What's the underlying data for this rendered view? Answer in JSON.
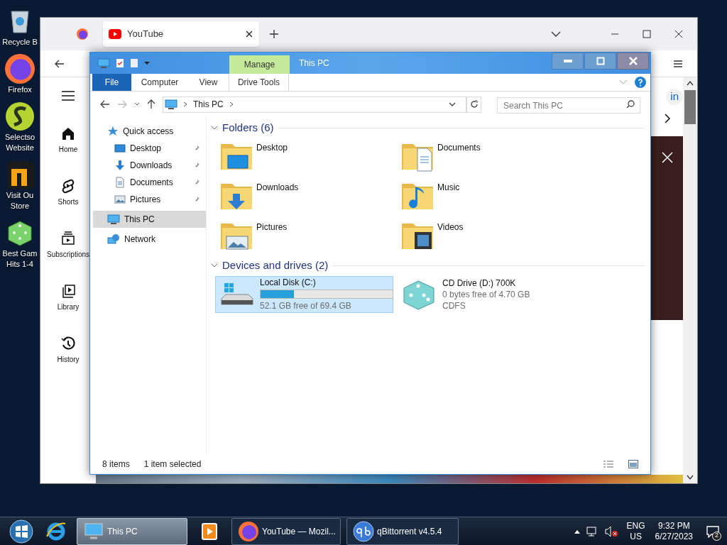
{
  "desktop": {
    "icons": [
      {
        "kind": "recycle",
        "lines": [
          "Recycle B"
        ]
      },
      {
        "kind": "firefox",
        "lines": [
          "Firefox"
        ]
      },
      {
        "kind": "selectsoft",
        "lines": [
          "Selectso",
          "Website"
        ]
      },
      {
        "kind": "store",
        "lines": [
          "Visit Ou",
          "Store"
        ]
      },
      {
        "kind": "dice",
        "lines": [
          "Best Gam",
          "Hits 1-4"
        ]
      }
    ]
  },
  "browser": {
    "tabs": [
      {
        "title": "YouTube",
        "selected": true
      }
    ],
    "sidebar": [
      {
        "kind": "home",
        "label": "Home"
      },
      {
        "kind": "shorts",
        "label": "Shorts"
      },
      {
        "kind": "subscriptions",
        "label": "Subscriptions"
      },
      {
        "kind": "library",
        "label": "Library"
      },
      {
        "kind": "history",
        "label": "History"
      }
    ],
    "sign_in_partial": "in"
  },
  "explorer": {
    "title": "This PC",
    "context_tab": "Manage",
    "ribbon_tabs": [
      {
        "kind": "file",
        "label": "File"
      },
      {
        "kind": "tab",
        "label": "Computer"
      },
      {
        "kind": "tab",
        "label": "View"
      },
      {
        "kind": "context",
        "label": "Drive Tools"
      }
    ],
    "address": "This PC",
    "search_placeholder": "Search This PC",
    "nav": [
      {
        "kind": "star",
        "label": "Quick access",
        "selected": false,
        "children": [
          {
            "kind": "desktop",
            "label": "Desktop",
            "selected": false,
            "pinned": true
          },
          {
            "kind": "downloads",
            "label": "Downloads",
            "selected": false,
            "pinned": true
          },
          {
            "kind": "documents",
            "label": "Documents",
            "selected": false,
            "pinned": true
          },
          {
            "kind": "pictures",
            "label": "Pictures",
            "selected": false,
            "pinned": true
          }
        ]
      },
      {
        "kind": "pc",
        "label": "This PC",
        "selected": true
      },
      {
        "kind": "network",
        "label": "Network",
        "selected": false
      }
    ],
    "sections": [
      {
        "kind": "folders",
        "title": "Folders (6)",
        "expanded": true,
        "items": [
          {
            "kind": "desktop",
            "name": "Desktop"
          },
          {
            "kind": "documents",
            "name": "Documents"
          },
          {
            "kind": "downloads",
            "name": "Downloads"
          },
          {
            "kind": "music",
            "name": "Music"
          },
          {
            "kind": "pictures",
            "name": "Pictures"
          },
          {
            "kind": "videos",
            "name": "Videos"
          }
        ]
      },
      {
        "kind": "drives",
        "title": "Devices and drives (2)",
        "expanded": true,
        "items": [
          {
            "kind": "disk",
            "name": "Local Disk (C:)",
            "level": 0.25,
            "lines": [
              "52.1 GB free of 69.4 GB"
            ],
            "selected": true
          },
          {
            "kind": "cd",
            "name": "CD Drive (D:) 700K",
            "lines": [
              "0 bytes free of 4.70 GB",
              "CDFS"
            ],
            "selected": false
          }
        ]
      }
    ],
    "status": [
      "8 items",
      "1 item selected"
    ]
  },
  "taskbar": {
    "buttons": [
      {
        "kind": "ie",
        "selected": false
      },
      {
        "kind": "pc",
        "label": "This PC",
        "selected": true
      },
      {
        "kind": "media",
        "selected": false
      },
      {
        "kind": "firefox",
        "label": "YouTube — Mozil...",
        "selected": false
      },
      {
        "kind": "qbittorrent",
        "label": "qBittorrent v4.5.4",
        "selected": false
      }
    ],
    "language": [
      "ENG",
      "US"
    ],
    "time": "9:32 PM",
    "date": "6/27/2023",
    "volume_muted": true,
    "notifications": "2"
  }
}
